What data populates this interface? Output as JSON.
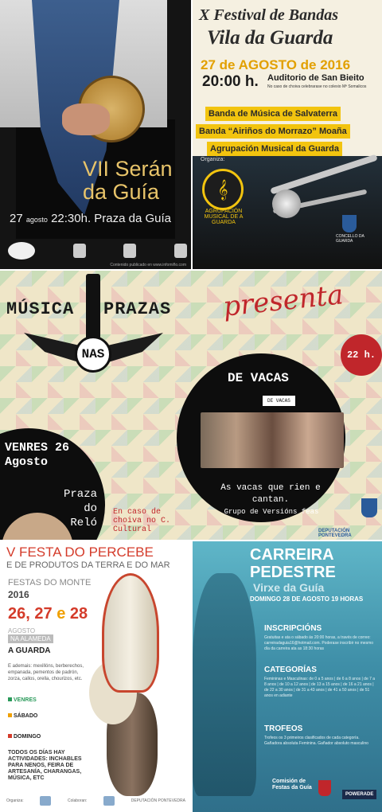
{
  "poster1": {
    "title_line1": "VII Serán",
    "title_line2": "da Guía",
    "day": "27",
    "month": "agosto",
    "time_place": "22:30h.  Praza da Guía",
    "credit": "Contenido publicado en www.infomiño.com"
  },
  "poster2": {
    "title_line1": "X Festival de Bandas",
    "title_line2": "Vila da Guarda",
    "date": "27 de AGOSTO de 2016",
    "time": "20:00 h.",
    "venue": "Auditorio de San Bieito",
    "note": "No caso de choiva celebrarase no colexio Mª Somalicos",
    "bands": [
      "Banda de Música de Salvaterra",
      "Banda “Airiños do Morrazo” Moaña",
      "Agrupación Musical da Guarda"
    ],
    "organiza_label": "Organiza:",
    "organiza_name": "AGRUPACIÓN MUSICAL DE A GUARDA",
    "crest_caption": "CONCELLO DA GUARDA"
  },
  "poster3": {
    "brand_left": "MÚSICA",
    "brand_right": "PRAZAS",
    "brand_center": "NAS",
    "presenta": "presenta",
    "hour": "22 h.",
    "band_name": "DE VACAS",
    "band_label": "DE VACAS",
    "tagline": "As vacas que rien e cantan.",
    "group": "Grupo de Versións feas",
    "day": "VENRES 26 Agosto",
    "place": "Praza do Reló",
    "rain": "En caso de choiva no C. Cultural",
    "dep": "DEPUTACIÓN PONTEVEDRA"
  },
  "poster4": {
    "title": "V FESTA DO PERCEBE",
    "subtitle": "E DE PRODUTOS DA TERRA E DO MAR",
    "festas": "FESTAS DO MONTE",
    "year": "2016",
    "day1": "26,",
    "day2": "27",
    "and": "e",
    "day3": "28",
    "month": "AGOSTO",
    "alameda": "NA ALAMEDA",
    "town": "A GUARDA",
    "food": "E ademais: mexillóns, berberechos, empanada, pementos de padrón, zorza, callos, orella, chourizos, etc.",
    "venres": "VENRES",
    "sabado": "SÁBADO",
    "domingo": "DOMINGO",
    "all": "TODOS OS DÍAS HAY ACTIVIDADES: INCHABLES PARA NENOS, FEIRA DE ARTESANÍA, CHARANGAS, MÚSICA, ETC",
    "org": "Organiza:",
    "collab": "Colaboran:",
    "dep": "DEPUTACIÓN PONTEVEDRA"
  },
  "poster5": {
    "title_line1": "CARREIRA",
    "title_line2": "PEDESTRE",
    "subtitle": "Virxe da Guía",
    "date": "DOMINGO 28 DE AGOSTO  19 HORAS",
    "h1": "INSCRIPCIÓNS",
    "t1": "Gratuitas e ata o sábado ás 20:00 horas, a través de correo: carreiradaguia16@hotmail.com. Poderase inscribir no mesmo día da carreira ata as 18:30 horas",
    "h2": "CATEGORÍAS",
    "t2": "Femininas e Masculinas: de 0 a 5 anos | de 6 a 8 anos | de 7 a 8 anos | de 10 a 12 anos | de 13 a 15 anos | de 16 a 21 anos | de 22 a 30 anos | de 31 a 43 anos | de 41 a 50 anos | de 51 anos en adiante",
    "h3": "TROFEOS",
    "t3": "Trofeos os 3 primeiros clasificados de cada categoría. Gañadora absoluta Feminina. Gañador absoluto masculino",
    "foot": "Comisión de Festas da Guía",
    "sponsor": "POWERADE"
  }
}
